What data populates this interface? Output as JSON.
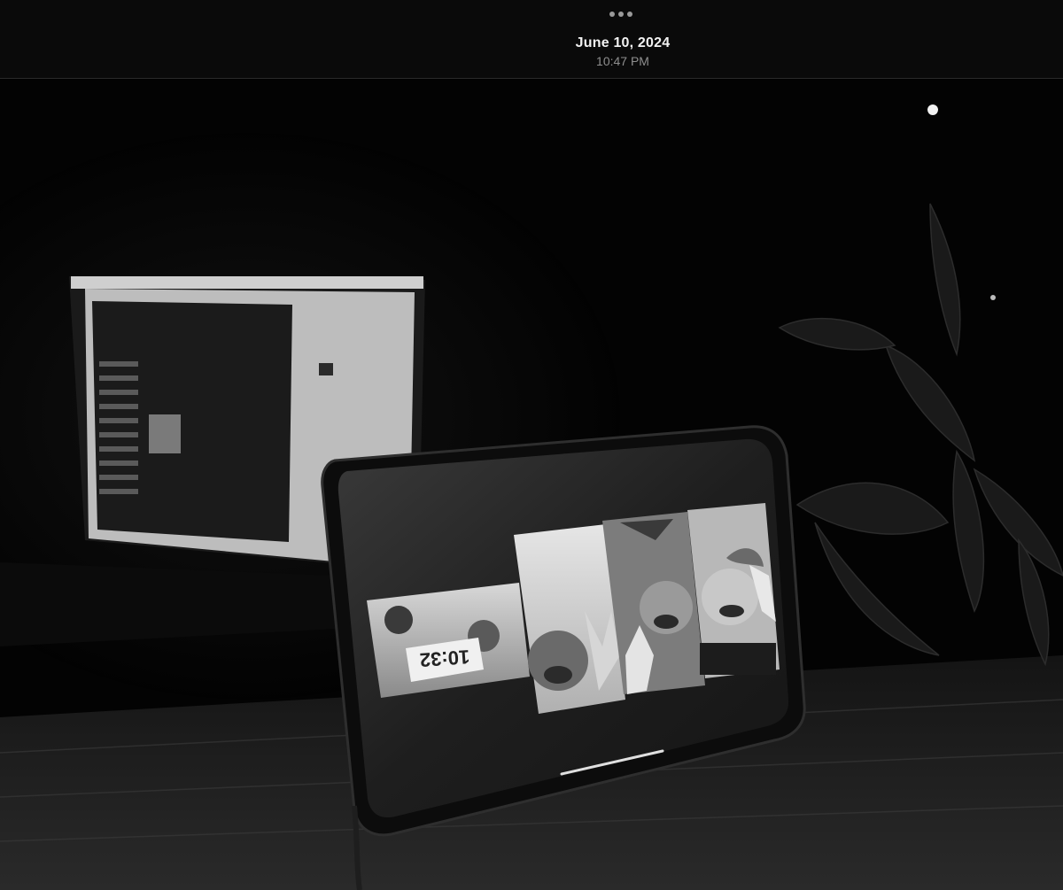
{
  "header": {
    "date": "June 10, 2024",
    "time": "10:47 PM",
    "more_icon": "ellipsis-icon"
  },
  "photo": {
    "tablet_clock_text": "10:32"
  }
}
